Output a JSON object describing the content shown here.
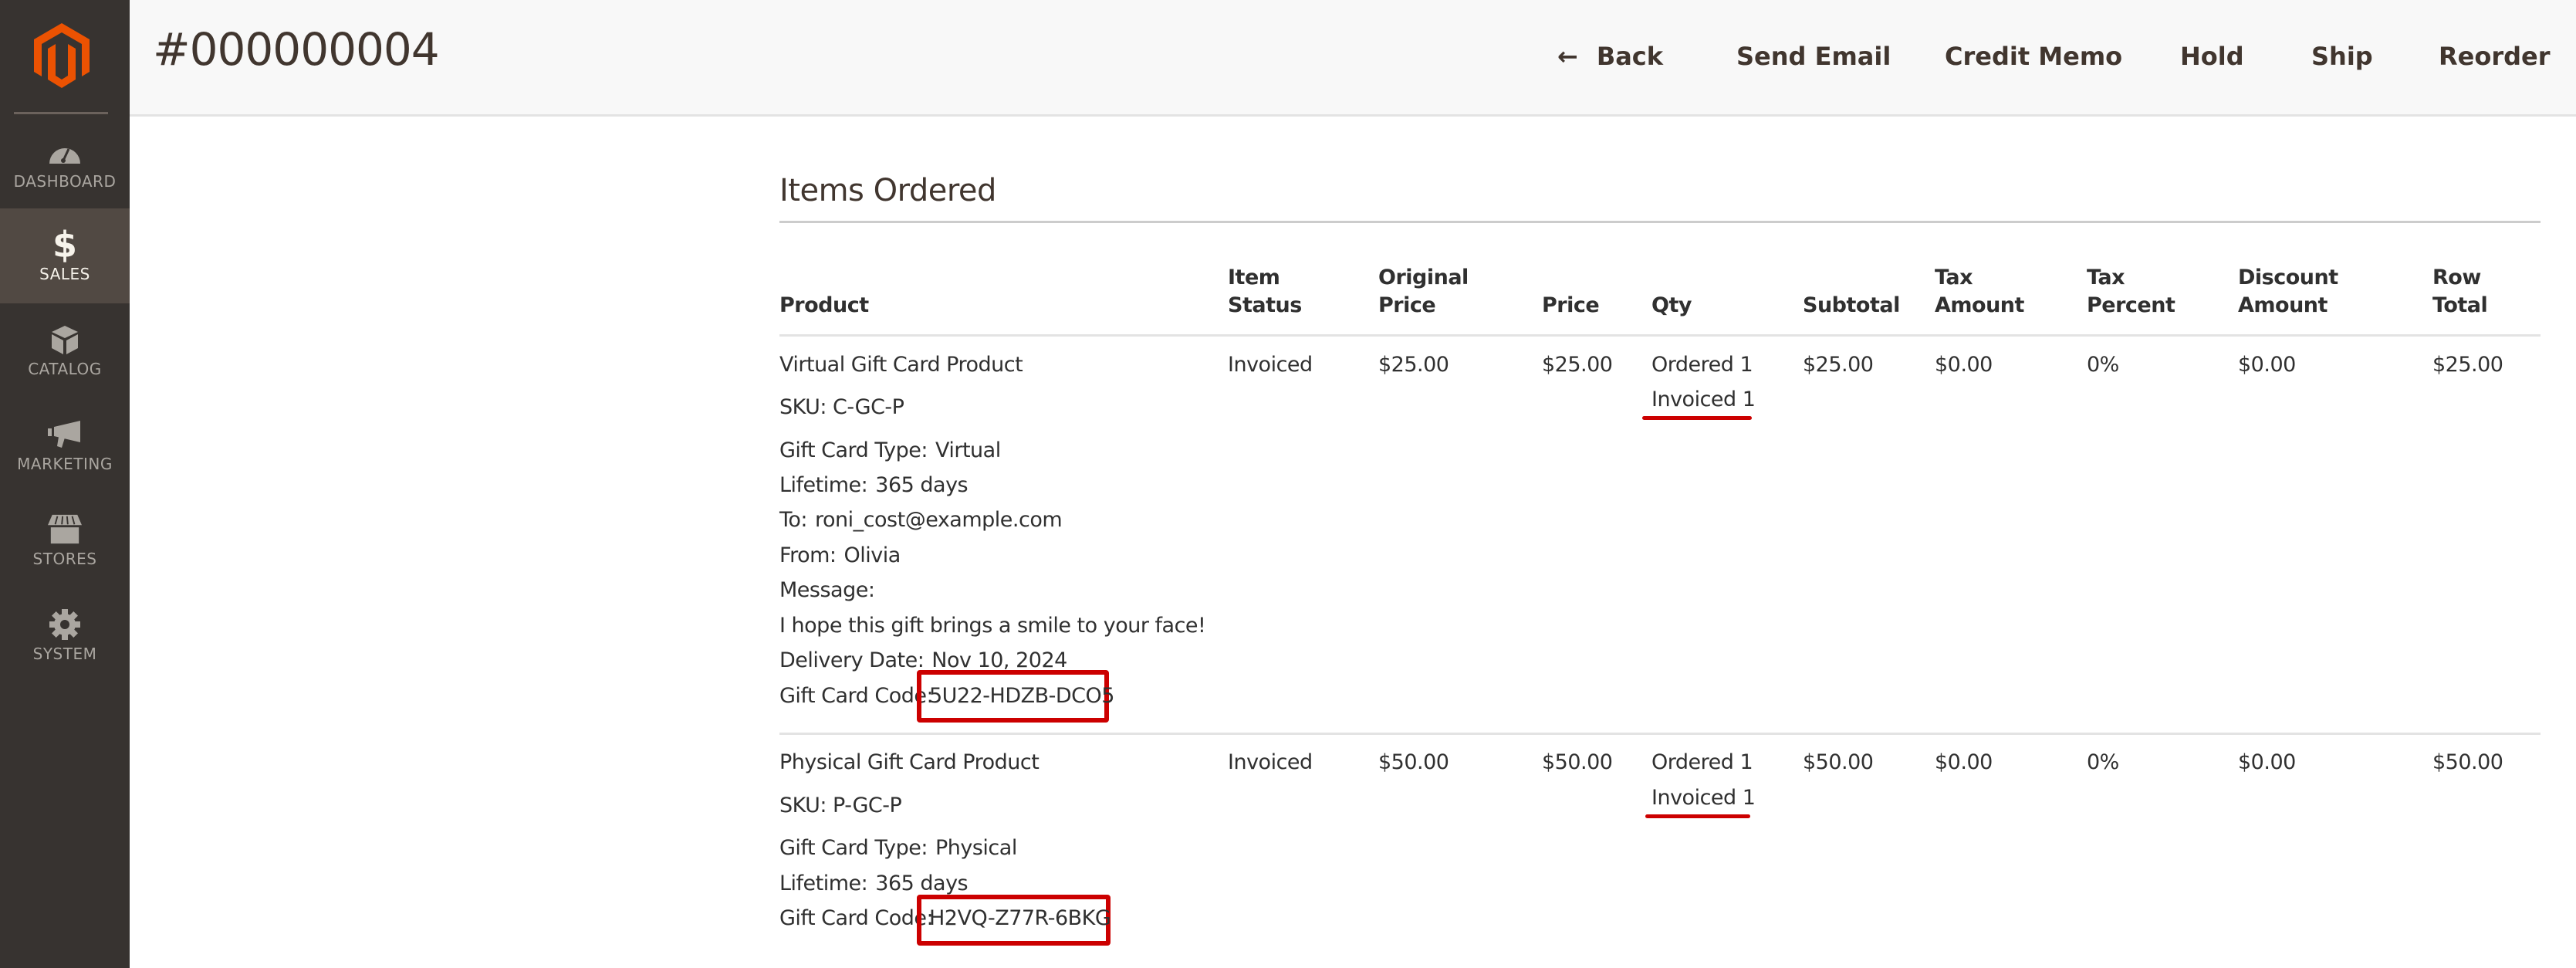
{
  "sidebar": {
    "logo": "magento-logo",
    "items": [
      {
        "label": "DASHBOARD",
        "icon": "dashboard-icon",
        "active": false
      },
      {
        "label": "SALES",
        "icon": "dollar-icon",
        "active": true
      },
      {
        "label": "CATALOG",
        "icon": "box-icon",
        "active": false
      },
      {
        "label": "MARKETING",
        "icon": "megaphone-icon",
        "active": false
      },
      {
        "label": "STORES",
        "icon": "store-icon",
        "active": false
      },
      {
        "label": "SYSTEM",
        "icon": "gear-icon",
        "active": false
      }
    ]
  },
  "header": {
    "title": "#000000004",
    "actions": {
      "back": "Back",
      "send_email": "Send Email",
      "credit_memo": "Credit Memo",
      "hold": "Hold",
      "ship": "Ship",
      "reorder": "Reorder"
    }
  },
  "items_ordered": {
    "title": "Items Ordered",
    "columns": {
      "product": "Product",
      "item_status": [
        "Item",
        "Status"
      ],
      "original_price": [
        "Original",
        "Price"
      ],
      "price": "Price",
      "qty": "Qty",
      "subtotal": "Subtotal",
      "tax_amount": [
        "Tax",
        "Amount"
      ],
      "tax_percent": [
        "Tax",
        "Percent"
      ],
      "discount_amount": [
        "Discount",
        "Amount"
      ],
      "row_total": [
        "Row",
        "Total"
      ]
    },
    "rows": [
      {
        "product_name": "Virtual Gift Card Product",
        "sku": "SKU: C-GC-P",
        "options": [
          {
            "label": "Gift Card Type:",
            "value": "Virtual"
          },
          {
            "label": "Lifetime:",
            "value": "365 days"
          },
          {
            "label": "To:",
            "value": "roni_cost@example.com"
          },
          {
            "label": "From:",
            "value": "Olivia"
          },
          {
            "label": "Message:",
            "value": ""
          },
          {
            "label": "",
            "value": "I hope this gift brings a smile to your face!"
          },
          {
            "label": "Delivery Date:",
            "value": "Nov 10, 2024"
          },
          {
            "label": "Gift Card Code:",
            "value": "5U22-HDZB-DCO5"
          }
        ],
        "item_status": "Invoiced",
        "original_price": "$25.00",
        "price": "$25.00",
        "qty_ordered": "Ordered 1",
        "qty_invoiced": "Invoiced 1",
        "subtotal": "$25.00",
        "tax_amount": "$0.00",
        "tax_percent": "0%",
        "discount_amount": "$0.00",
        "row_total": "$25.00"
      },
      {
        "product_name": "Physical Gift Card Product",
        "sku": "SKU: P-GC-P",
        "options": [
          {
            "label": "Gift Card Type:",
            "value": "Physical"
          },
          {
            "label": "Lifetime:",
            "value": "365 days"
          },
          {
            "label": "Gift Card Code:",
            "value": "H2VQ-Z77R-6BKG"
          }
        ],
        "item_status": "Invoiced",
        "original_price": "$50.00",
        "price": "$50.00",
        "qty_ordered": "Ordered 1",
        "qty_invoiced": "Invoiced 1",
        "subtotal": "$50.00",
        "tax_amount": "$0.00",
        "tax_percent": "0%",
        "discount_amount": "$0.00",
        "row_total": "$50.00"
      }
    ]
  },
  "annotations": {
    "highlight_color": "#cc0000"
  }
}
